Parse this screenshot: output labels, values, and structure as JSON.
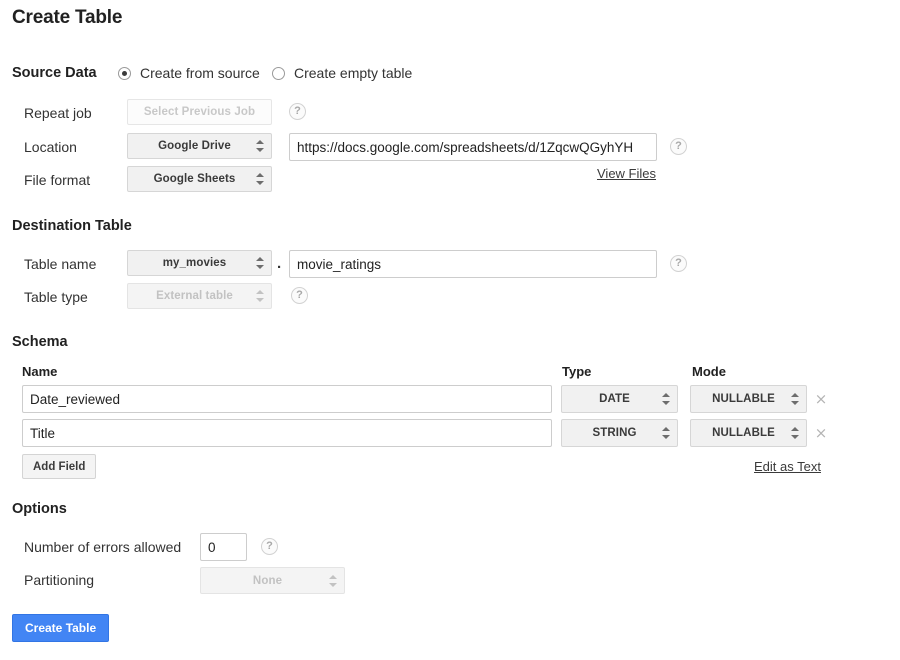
{
  "page_title": "Create Table",
  "source_data": {
    "heading": "Source Data",
    "radios": [
      {
        "label": "Create from source",
        "checked": true
      },
      {
        "label": "Create empty table",
        "checked": false
      }
    ],
    "rows": {
      "repeat_job": {
        "label": "Repeat job",
        "select_placeholder": "Select Previous Job",
        "help": "?"
      },
      "location": {
        "label": "Location",
        "select_value": "Google Drive",
        "url_value": "https://docs.google.com/spreadsheets/d/1ZqcwQGyhYH",
        "help": "?",
        "view_files_link": "View Files"
      },
      "file_format": {
        "label": "File format",
        "select_value": "Google Sheets"
      }
    }
  },
  "destination_table": {
    "heading": "Destination Table",
    "table_name": {
      "label": "Table name",
      "dataset_value": "my_movies",
      "separator": ".",
      "table_value": "movie_ratings",
      "help": "?"
    },
    "table_type": {
      "label": "Table type",
      "value": "External table",
      "help": "?"
    }
  },
  "schema": {
    "heading": "Schema",
    "columns": {
      "name": "Name",
      "type": "Type",
      "mode": "Mode"
    },
    "fields": [
      {
        "name": "Date_reviewed",
        "type": "DATE",
        "mode": "NULLABLE",
        "remove": "×"
      },
      {
        "name": "Title",
        "type": "STRING",
        "mode": "NULLABLE",
        "remove": "×"
      }
    ],
    "add_field_label": "Add Field",
    "edit_as_text_link": "Edit as Text"
  },
  "options": {
    "heading": "Options",
    "errors_allowed": {
      "label": "Number of errors allowed",
      "value": "0",
      "help": "?"
    },
    "partitioning": {
      "label": "Partitioning",
      "value": "None"
    }
  },
  "submit": {
    "label": "Create Table"
  },
  "colors": {
    "primary_button": "#4285f4",
    "select_bg": "#f1f1f1",
    "border": "#cdcdcd",
    "disabled_text": "#c2c2c2"
  }
}
